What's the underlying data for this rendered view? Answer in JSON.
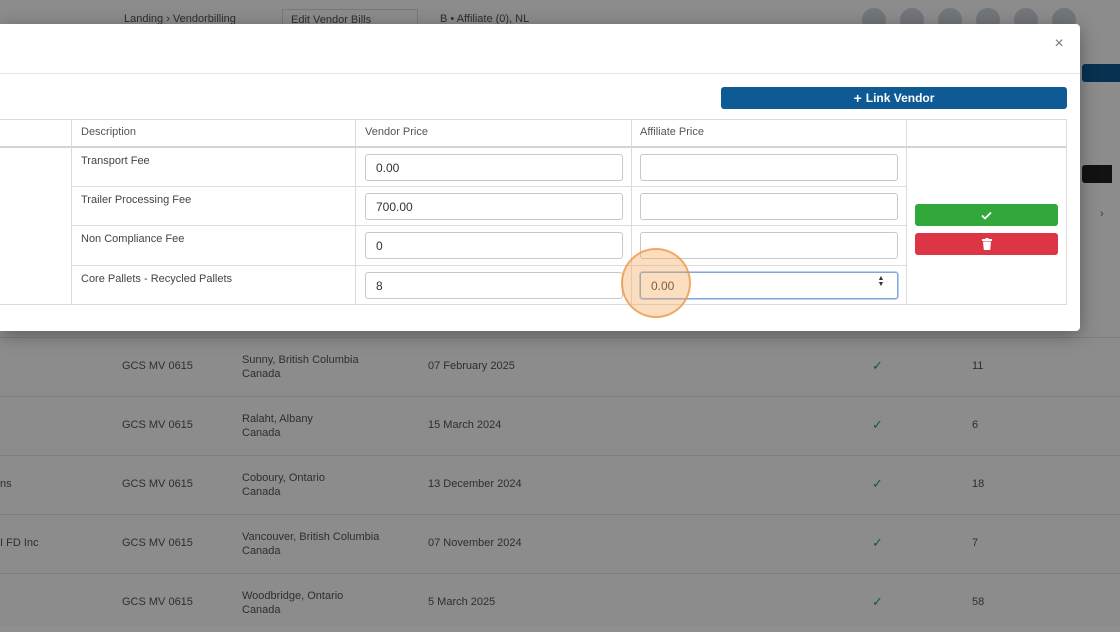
{
  "background": {
    "breadcrumb": "Landing › Vendorbilling",
    "active_tab": "Edit Vendor Bills",
    "meta": "B • Affiliate (0), NL",
    "rows": [
      {
        "name": "",
        "code": "GCS MV 0615",
        "location": "Sunny, British Columbia",
        "sub": "Canada",
        "date": "07 February 2025",
        "num": "11"
      },
      {
        "name": "",
        "code": "GCS MV 0615",
        "location": "Ralaht, Albany",
        "sub": "Canada",
        "date": "15 March 2024",
        "num": "6"
      },
      {
        "name": "ns",
        "code": "GCS MV 0615",
        "location": "Coboury, Ontario",
        "sub": "Canada",
        "date": "13 December 2024",
        "num": "18"
      },
      {
        "name": "I FD Inc",
        "code": "GCS MV 0615",
        "location": "Vancouver, British Columbia",
        "sub": "Canada",
        "date": "07 November 2024",
        "num": "7"
      },
      {
        "name": "",
        "code": "GCS MV 0615",
        "location": "Woodbridge, Ontario",
        "sub": "Canada",
        "date": "5 March 2025",
        "num": "58"
      }
    ]
  },
  "modal": {
    "close_icon": "×",
    "link_vendor": {
      "icon": "plus-icon",
      "label": "Link Vendor"
    },
    "columns": [
      "Description",
      "Vendor Price",
      "Affiliate Price"
    ],
    "rows": [
      {
        "description": "Transport Fee",
        "vendor_price": "0.00",
        "affiliate_price": ""
      },
      {
        "description": "Trailer Processing Fee",
        "vendor_price": "700.00",
        "affiliate_price": ""
      },
      {
        "description": "Non Compliance Fee",
        "vendor_price": "0",
        "affiliate_price": ""
      },
      {
        "description": "Core Pallets - Recycled Pallets",
        "vendor_price": "8",
        "affiliate_price": "0.00"
      }
    ],
    "actions": {
      "confirm_icon": "check-icon",
      "delete_icon": "trash-icon"
    }
  },
  "colors": {
    "primary": "#0d5a94",
    "success": "#33a83a",
    "danger": "#dc3545",
    "click_highlight": "#f5a65a"
  }
}
